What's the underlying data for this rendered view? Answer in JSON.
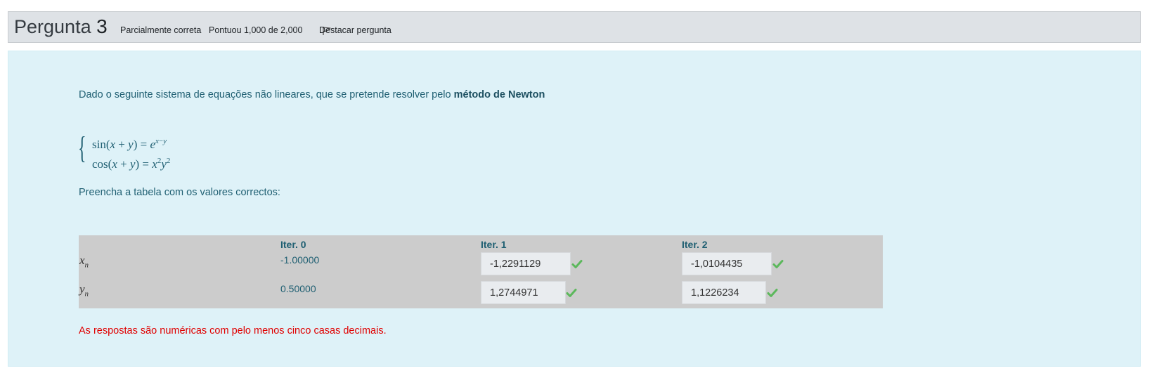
{
  "header": {
    "question_word": "Pergunta",
    "question_number": "3",
    "state": "Parcialmente correta",
    "grade": "Pontuou 1,000 de 2,000",
    "flag_label": "Destacar pergunta"
  },
  "content": {
    "intro_text": "Dado o seguinte sistema de equações não lineares, que se pretende resolver pelo ",
    "intro_bold": "método de Newton",
    "fill_instruction": "Preencha a tabela com os valores correctos:",
    "note": "As respostas são numéricas com pelo menos cinco casas decimais."
  },
  "table": {
    "headers": [
      "Iter. 0",
      "Iter. 1",
      "Iter. 2"
    ],
    "rows": [
      {
        "var": "x",
        "sub": "n",
        "iter0": "-1.00000",
        "iter1": "-1,2291129",
        "iter2": "-1,0104435"
      },
      {
        "var": "y",
        "sub": "n",
        "iter0": "0.50000",
        "iter1": "1,2744971",
        "iter2": "1,1226234"
      }
    ]
  },
  "colors": {
    "header_bg": "#dee2e6",
    "content_bg": "#def2f8",
    "table_bg": "#cccccc",
    "text_teal": "#1f5f72",
    "correct_green": "#5cb85c",
    "note_red": "#e00000"
  },
  "icons": {
    "flag": "flag-icon",
    "correct": "check-icon"
  }
}
